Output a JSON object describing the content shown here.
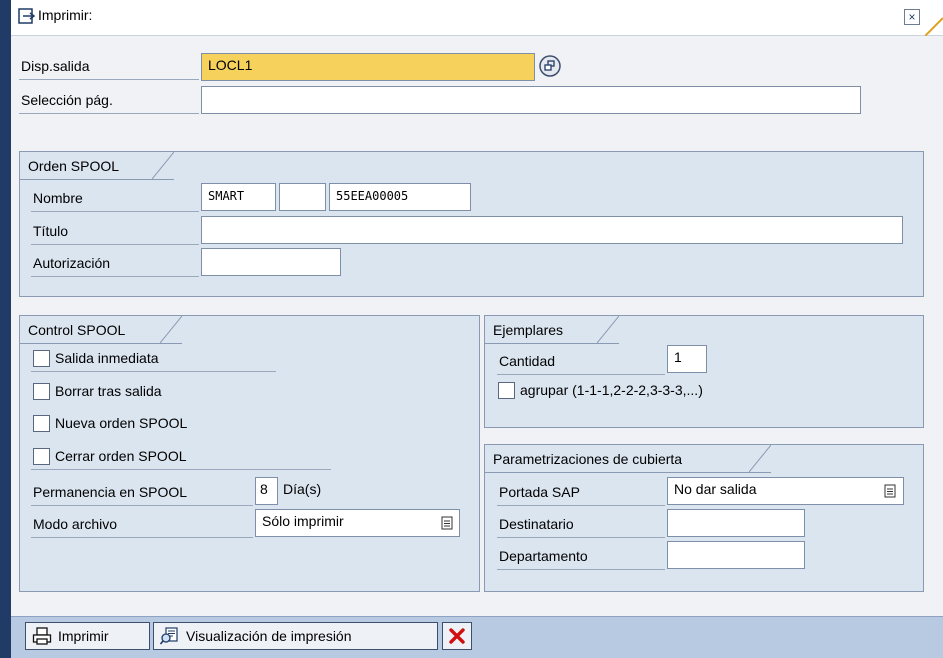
{
  "window": {
    "title": "Imprimir:",
    "close_symbol": "×"
  },
  "output": {
    "device_label": "Disp.salida",
    "device_value": "LOCL1",
    "page_selection_label": "Selección pág.",
    "page_selection_value": ""
  },
  "spool_request": {
    "title": "Orden SPOOL",
    "name_label": "Nombre",
    "name_part1": "SMART",
    "name_part2": "",
    "name_part3": "55EEA00005",
    "title_label": "Título",
    "title_value": "",
    "auth_label": "Autorización",
    "auth_value": ""
  },
  "spool_control": {
    "title": "Control SPOOL",
    "print_immediately": "Salida inmediata",
    "delete_after": "Borrar tras salida",
    "new_request": "Nueva orden SPOOL",
    "close_request": "Cerrar orden SPOOL",
    "retention_label": "Permanencia en SPOOL",
    "retention_value": "8",
    "retention_unit": "Día(s)",
    "archive_label": "Modo archivo",
    "archive_value": "Sólo imprimir"
  },
  "copies": {
    "title": "Ejemplares",
    "quantity_label": "Cantidad",
    "quantity_value": "1",
    "group_label": "agrupar (1-1-1,2-2-2,3-3-3,...)"
  },
  "cover": {
    "title": "Parametrizaciones de cubierta",
    "sap_cover_label": "Portada SAP",
    "sap_cover_value": "No dar salida",
    "recipient_label": "Destinatario",
    "recipient_value": "",
    "department_label": "Departamento",
    "department_value": ""
  },
  "toolbar": {
    "print_label": "Imprimir",
    "preview_label": "Visualización de impresión"
  },
  "colors": {
    "frame": "#1f3b66",
    "group_bg": "#dbe5f0",
    "required_field": "#f6d25c",
    "toolbar_bg": "#b8c9e2",
    "cancel_red": "#d01010"
  }
}
